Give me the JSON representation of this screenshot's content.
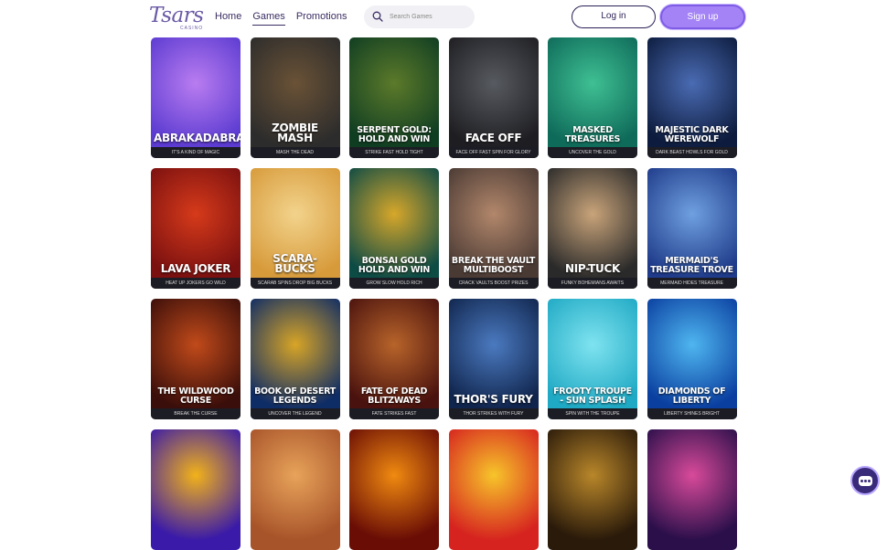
{
  "header": {
    "logo_text": "Tsars",
    "logo_sub": "CASINO",
    "nav": [
      "Home",
      "Games",
      "Promotions"
    ],
    "active_nav": "Games",
    "search_placeholder": "Search Games",
    "login_label": "Log in",
    "signup_label": "Sign up"
  },
  "games": [
    {
      "title": "Abrakadabra",
      "tag": "It's a kind of magic",
      "colors": [
        "#5b3bd1",
        "#b97cf0"
      ]
    },
    {
      "title": "Zombie Mash",
      "tag": "Mash the dead",
      "colors": [
        "#2c2c2c",
        "#6a5236"
      ]
    },
    {
      "title": "Serpent Gold: Hold and Win",
      "tag": "Strike fast hold tight",
      "colors": [
        "#0f3d22",
        "#5c7a2a"
      ]
    },
    {
      "title": "Face Off",
      "tag": "Face off fast spin for glory",
      "colors": [
        "#1e1e22",
        "#575a60"
      ]
    },
    {
      "title": "Masked Treasures",
      "tag": "Uncover the gold",
      "colors": [
        "#0e6a59",
        "#3fc093"
      ]
    },
    {
      "title": "Majestic Dark Werewolf",
      "tag": "Dark beast howls for gold",
      "colors": [
        "#0d1c3e",
        "#4a6bb3"
      ]
    },
    {
      "title": "Lava Joker",
      "tag": "Heat up jokers go wild",
      "colors": [
        "#7a1010",
        "#d63a1a"
      ]
    },
    {
      "title": "Scara-Bucks",
      "tag": "Scarab spins drop big bucks",
      "colors": [
        "#d79a3a",
        "#f2d38c"
      ]
    },
    {
      "title": "Bonsai Gold Hold and Win",
      "tag": "Grow slow hold rich",
      "colors": [
        "#0d4b45",
        "#d7a72a"
      ]
    },
    {
      "title": "Break the Vault Multiboost",
      "tag": "Crack vaults boost prizes",
      "colors": [
        "#4a3a34",
        "#b2876b"
      ]
    },
    {
      "title": "Nip-Tuck",
      "tag": "Funky bohemians awaits",
      "colors": [
        "#2a2a2a",
        "#c9a47a"
      ]
    },
    {
      "title": "Mermaid's Treasure Trove",
      "tag": "Mermaid hides treasure",
      "colors": [
        "#1f3b8a",
        "#6fa0e0"
      ]
    },
    {
      "title": "The Wildwood Curse",
      "tag": "Break the curse",
      "colors": [
        "#3a0e0a",
        "#c14a1a"
      ]
    },
    {
      "title": "Book of Desert Legends",
      "tag": "Uncover the legend",
      "colors": [
        "#0e2c66",
        "#d8a526"
      ]
    },
    {
      "title": "Fate of Dead Blitzways",
      "tag": "Fate strikes fast",
      "colors": [
        "#4a120e",
        "#b8642a"
      ]
    },
    {
      "title": "Thor's Fury",
      "tag": "Thor strikes with fury",
      "colors": [
        "#10254d",
        "#4b7ac0"
      ]
    },
    {
      "title": "Frooty Troupe - Sun Splash",
      "tag": "Spin with the troupe",
      "colors": [
        "#1fa9c4",
        "#7fe3f0"
      ]
    },
    {
      "title": "Diamonds of Liberty",
      "tag": "Liberty shines bright",
      "colors": [
        "#0a3fa0",
        "#4fb6f0"
      ]
    },
    {
      "title": "",
      "tag": "",
      "colors": [
        "#3a1aa8",
        "#f2b21a"
      ]
    },
    {
      "title": "",
      "tag": "",
      "colors": [
        "#a8542a",
        "#e8a35a"
      ]
    },
    {
      "title": "",
      "tag": "",
      "colors": [
        "#6a0d05",
        "#f08a10"
      ]
    },
    {
      "title": "",
      "tag": "",
      "colors": [
        "#d6231f",
        "#f7c52a"
      ]
    },
    {
      "title": "",
      "tag": "",
      "colors": [
        "#2a1a0a",
        "#b9872a"
      ]
    },
    {
      "title": "",
      "tag": "",
      "colors": [
        "#2a0f4a",
        "#d84a9a"
      ]
    }
  ]
}
